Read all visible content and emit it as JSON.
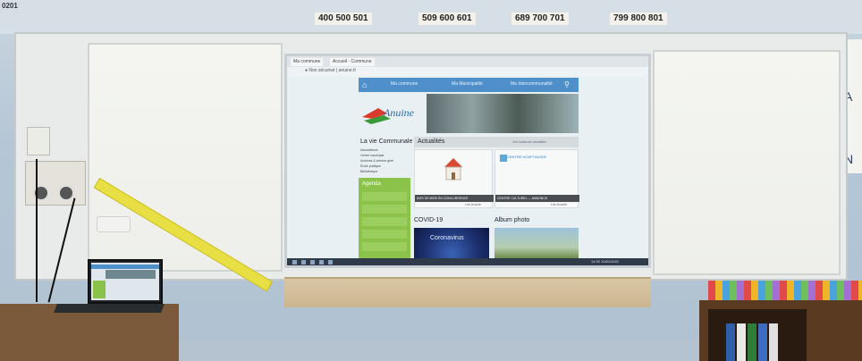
{
  "top_cards": [
    "400 500 501",
    "509 600 601",
    "689 700 701",
    "799 800 801"
  ],
  "corner_label": "0201",
  "website": {
    "browser_tabs": [
      "Ma commune",
      "Accueil - Commune"
    ],
    "url": "● Non sécurisé | anuine.fr",
    "nav": [
      "Ma commune",
      "Ma Municipalité",
      "Ma Intercommunalité"
    ],
    "logo_text": "Anuine",
    "vie_communale": {
      "title": "La vie Communale",
      "links": [
        "Associations",
        "Centre municipal",
        "Archives & cinéma géré",
        "École publique",
        "Bibliothèque"
      ]
    },
    "green_panel": {
      "title": "Agenda"
    },
    "actus": {
      "title": "Actualités",
      "links": "Voir toutes les actualités",
      "cards": [
        {
          "caption": "AVIS DE MISE EN CONCURRENCE",
          "link": "Lire la suite"
        },
        {
          "caption": "CENTRE CULTUREL — ANNONCE",
          "link": "Lire la suite",
          "logo": "CENTRE HOSPITALIER"
        }
      ]
    },
    "covid": {
      "title": "COVID-19",
      "image_text": "Coronavirus"
    },
    "album": {
      "title": "Album photo"
    },
    "clock": "14:32 10/01/2021"
  },
  "colors": {
    "site_nav": "#4f8fca",
    "green_panel": "#8bc34a",
    "ruler": "#e8df45"
  }
}
